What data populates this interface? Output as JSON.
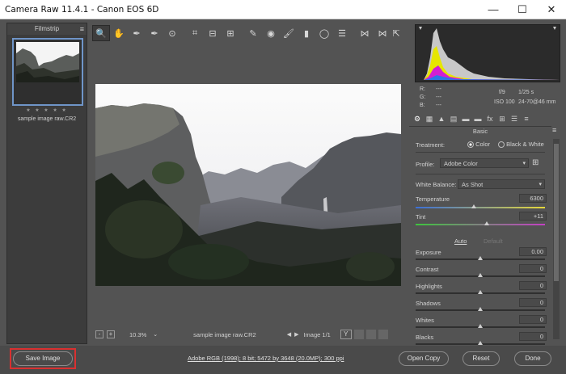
{
  "window": {
    "title": "Camera Raw 11.4.1  -  Canon EOS 6D",
    "minimize_glyph": "—",
    "maximize_glyph": "☐",
    "close_glyph": "✕"
  },
  "filmstrip": {
    "header": "Filmstrip",
    "menu_icon": "≡",
    "stars": "★ ★ ★ ★ ★",
    "thumb_name": "sample image raw.CR2"
  },
  "toolbar": {
    "tools": [
      {
        "name": "zoom-tool-icon",
        "glyph": "🔍"
      },
      {
        "name": "hand-tool-icon",
        "glyph": "✋"
      },
      {
        "name": "white-balance-tool-icon",
        "glyph": "✒"
      },
      {
        "name": "color-sampler-tool-icon",
        "glyph": "✒"
      },
      {
        "name": "targeted-adjustment-tool-icon",
        "glyph": "⊙"
      },
      {
        "name": "crop-tool-icon",
        "glyph": "⌗"
      },
      {
        "name": "straighten-tool-icon",
        "glyph": "⊟"
      },
      {
        "name": "transform-tool-icon",
        "glyph": "⊞"
      },
      {
        "name": "spot-removal-tool-icon",
        "glyph": "✎"
      },
      {
        "name": "red-eye-tool-icon",
        "glyph": "◉"
      },
      {
        "name": "adjustment-brush-icon",
        "glyph": "🖌"
      },
      {
        "name": "graduated-filter-icon",
        "glyph": "▮"
      },
      {
        "name": "radial-filter-icon",
        "glyph": "◯"
      },
      {
        "name": "preferences-icon",
        "glyph": "☰"
      },
      {
        "name": "rotate-ccw-icon",
        "glyph": "⋈"
      },
      {
        "name": "rotate-cw-icon",
        "glyph": "⋈"
      }
    ],
    "export_glyph": "⇱"
  },
  "canvasbar": {
    "zoom_minus": "-",
    "zoom_plus": "+",
    "zoom": "10.3%",
    "zoom_dd": "⌄",
    "filename": "sample image raw.CR2",
    "prev": "◀",
    "next": "▶",
    "image_count": "Image 1/1",
    "yy": "Y"
  },
  "exif": {
    "r_label": "R:",
    "g_label": "G:",
    "b_label": "B:",
    "r_val": "---",
    "g_val": "---",
    "b_val": "---",
    "aperture": "f/9",
    "shutter": "1/25 s",
    "iso": "ISO 100",
    "lens": "24-70@46 mm"
  },
  "panel_tabs": [
    "⚙",
    "▦",
    "▲",
    "▤",
    "▬",
    "▬",
    "fx",
    "⊞",
    "☰",
    "≡"
  ],
  "panel": {
    "title": "Basic",
    "menu_icon": "≡",
    "treatment_label": "Treatment:",
    "treatment_color": "Color",
    "treatment_bw": "Black & White",
    "profile_label": "Profile:",
    "profile_value": "Adobe Color",
    "wb_label": "White Balance:",
    "wb_value": "As Shot",
    "temperature_label": "Temperature",
    "temperature_value": "6300",
    "tint_label": "Tint",
    "tint_value": "+11",
    "auto": "Auto",
    "default": "Default",
    "sliders": [
      {
        "label": "Exposure",
        "value": "0.00",
        "level": 0.5
      },
      {
        "label": "Contrast",
        "value": "0",
        "level": 0.5
      },
      {
        "label": "Highlights",
        "value": "0",
        "level": 0.5
      },
      {
        "label": "Shadows",
        "value": "0",
        "level": 0.5
      },
      {
        "label": "Whites",
        "value": "0",
        "level": 0.5
      },
      {
        "label": "Blacks",
        "value": "0",
        "level": 0.5
      }
    ],
    "temperature_level": 0.45,
    "tint_level": 0.55
  },
  "footer": {
    "save_label": "Save Image",
    "workflow_link": "Adobe RGB (1998); 8 bit; 5472 by 3648 (20.0MP); 300 ppi",
    "open_label": "Open Copy",
    "reset_label": "Reset",
    "done_label": "Done"
  },
  "colors": {
    "accent_blue": "#6f95c8",
    "highlight_red": "#d93030"
  }
}
